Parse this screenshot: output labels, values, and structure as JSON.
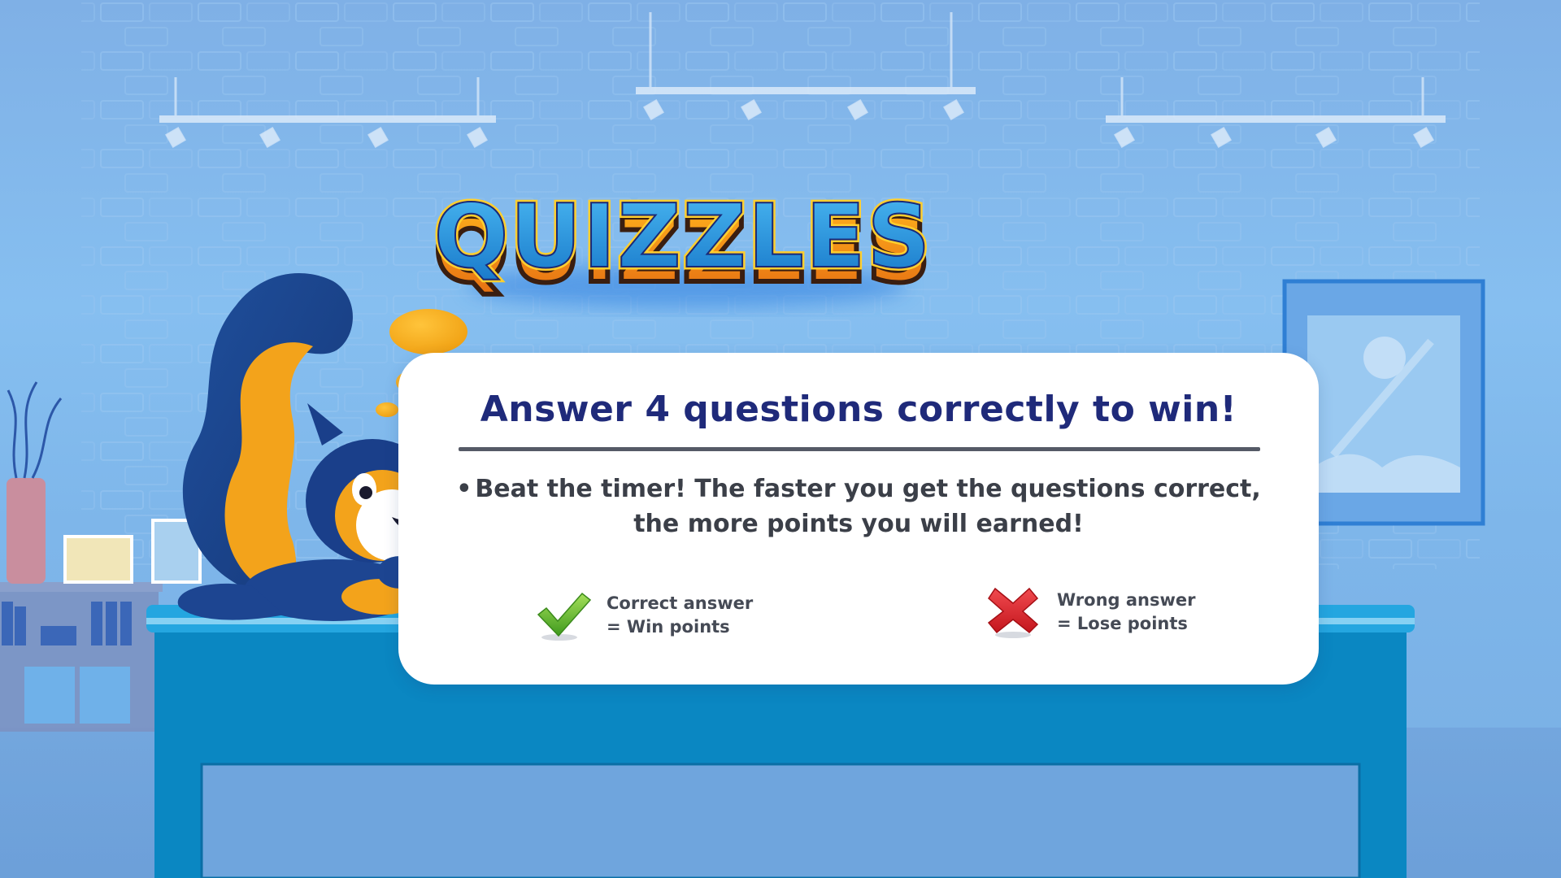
{
  "game": {
    "logo_text": "QUIZZLES"
  },
  "rules": {
    "title": "Answer 4 questions correctly to win!",
    "bullet": "•",
    "description_line1": "Beat the timer! The faster you get the questions correct,",
    "description_line2": "the more points you will earned!"
  },
  "legend": {
    "correct": {
      "icon": "checkmark-icon",
      "line1": "Correct answer",
      "line2": "= Win points",
      "color": "#5cb82a"
    },
    "wrong": {
      "icon": "cross-icon",
      "line1": "Wrong answer",
      "line2": "= Lose points",
      "color": "#d8232a"
    }
  },
  "colors": {
    "title": "#1f2a7a",
    "background": "#86bff0",
    "desk": "#0a87c2",
    "logo_fill": "#1e8fd6",
    "logo_outline": "#ffc21a",
    "mascot_body": "#1a3f8a",
    "mascot_accent": "#f3a31b"
  }
}
